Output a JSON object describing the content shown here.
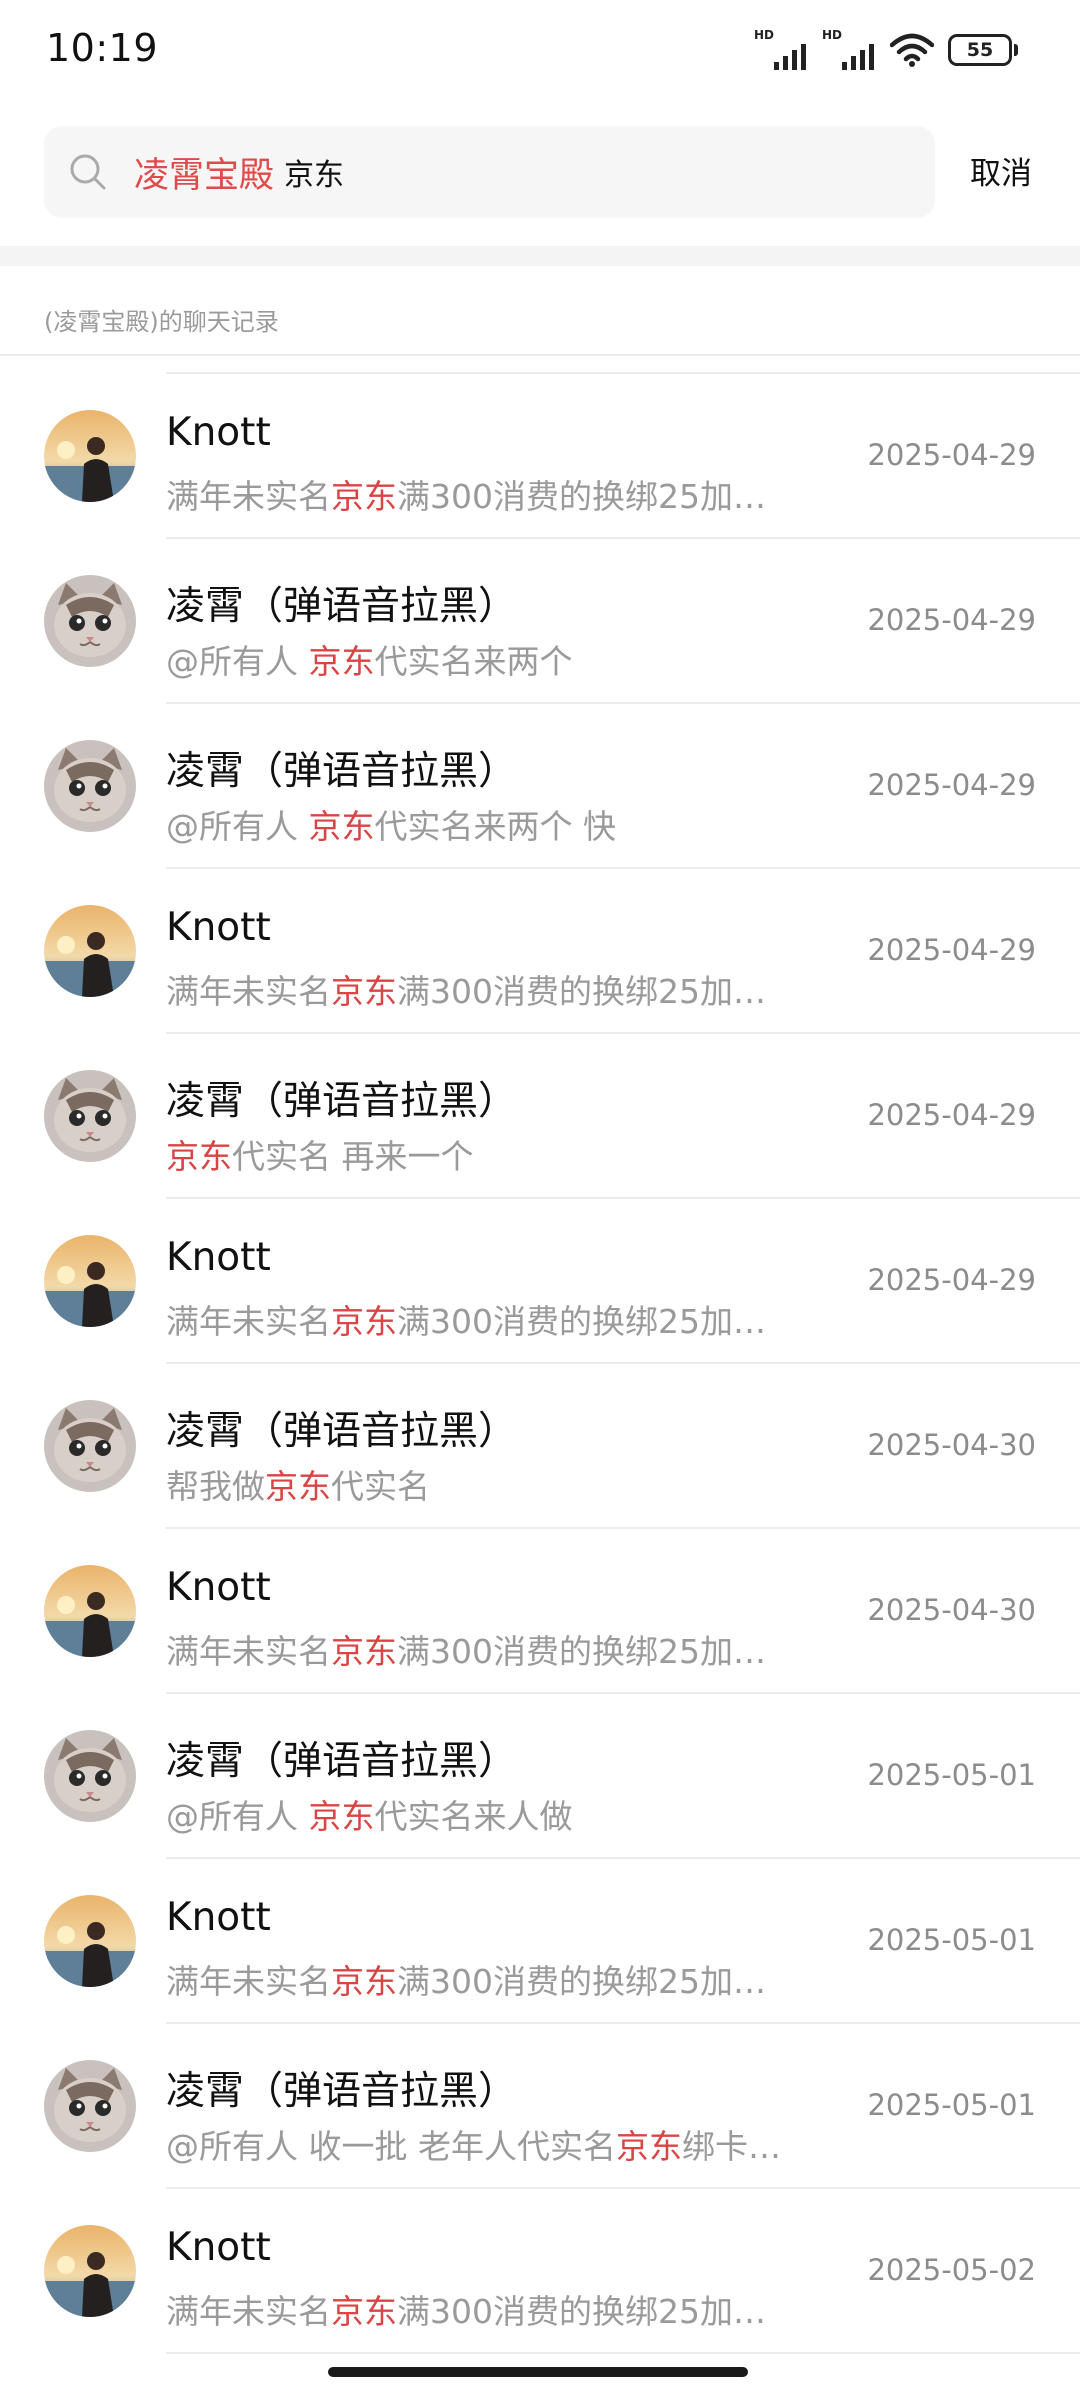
{
  "status": {
    "time": "10:19",
    "sim1": "HD",
    "sim2": "HD",
    "battery": "55"
  },
  "search": {
    "tag": "凌霄宝殿",
    "query": "京东",
    "cancel_label": "取消"
  },
  "section": {
    "label": "(凌霄宝殿)的聊天记录"
  },
  "results": [
    {
      "name": "Knott",
      "avatar": "person",
      "pre": "满年未实名",
      "hl": "京东",
      "post": "满300消费的换绑25加…",
      "date": "2025-04-29"
    },
    {
      "name": "凌霄（弹语音拉黑）",
      "avatar": "cat",
      "pre": "@所有人 ",
      "hl": "京东",
      "post": "代实名来两个",
      "date": "2025-04-29"
    },
    {
      "name": "凌霄（弹语音拉黑）",
      "avatar": "cat",
      "pre": "@所有人 ",
      "hl": "京东",
      "post": "代实名来两个 快",
      "date": "2025-04-29"
    },
    {
      "name": "Knott",
      "avatar": "person",
      "pre": "满年未实名",
      "hl": "京东",
      "post": "满300消费的换绑25加…",
      "date": "2025-04-29"
    },
    {
      "name": "凌霄（弹语音拉黑）",
      "avatar": "cat",
      "pre": "",
      "hl": "京东",
      "post": "代实名 再来一个",
      "date": "2025-04-29"
    },
    {
      "name": "Knott",
      "avatar": "person",
      "pre": "满年未实名",
      "hl": "京东",
      "post": "满300消费的换绑25加…",
      "date": "2025-04-29"
    },
    {
      "name": "凌霄（弹语音拉黑）",
      "avatar": "cat",
      "pre": "帮我做",
      "hl": "京东",
      "post": "代实名",
      "date": "2025-04-30"
    },
    {
      "name": "Knott",
      "avatar": "person",
      "pre": "满年未实名",
      "hl": "京东",
      "post": "满300消费的换绑25加…",
      "date": "2025-04-30"
    },
    {
      "name": "凌霄（弹语音拉黑）",
      "avatar": "cat",
      "pre": "@所有人 ",
      "hl": "京东",
      "post": "代实名来人做",
      "date": "2025-05-01"
    },
    {
      "name": "Knott",
      "avatar": "person",
      "pre": "满年未实名",
      "hl": "京东",
      "post": "满300消费的换绑25加…",
      "date": "2025-05-01"
    },
    {
      "name": "凌霄（弹语音拉黑）",
      "avatar": "cat",
      "pre": "@所有人  收一批 老年人代实名",
      "hl": "京东",
      "post": "绑卡…",
      "date": "2025-05-01"
    },
    {
      "name": "Knott",
      "avatar": "person",
      "pre": "满年未实名",
      "hl": "京东",
      "post": "满300消费的换绑25加…",
      "date": "2025-05-02"
    }
  ]
}
